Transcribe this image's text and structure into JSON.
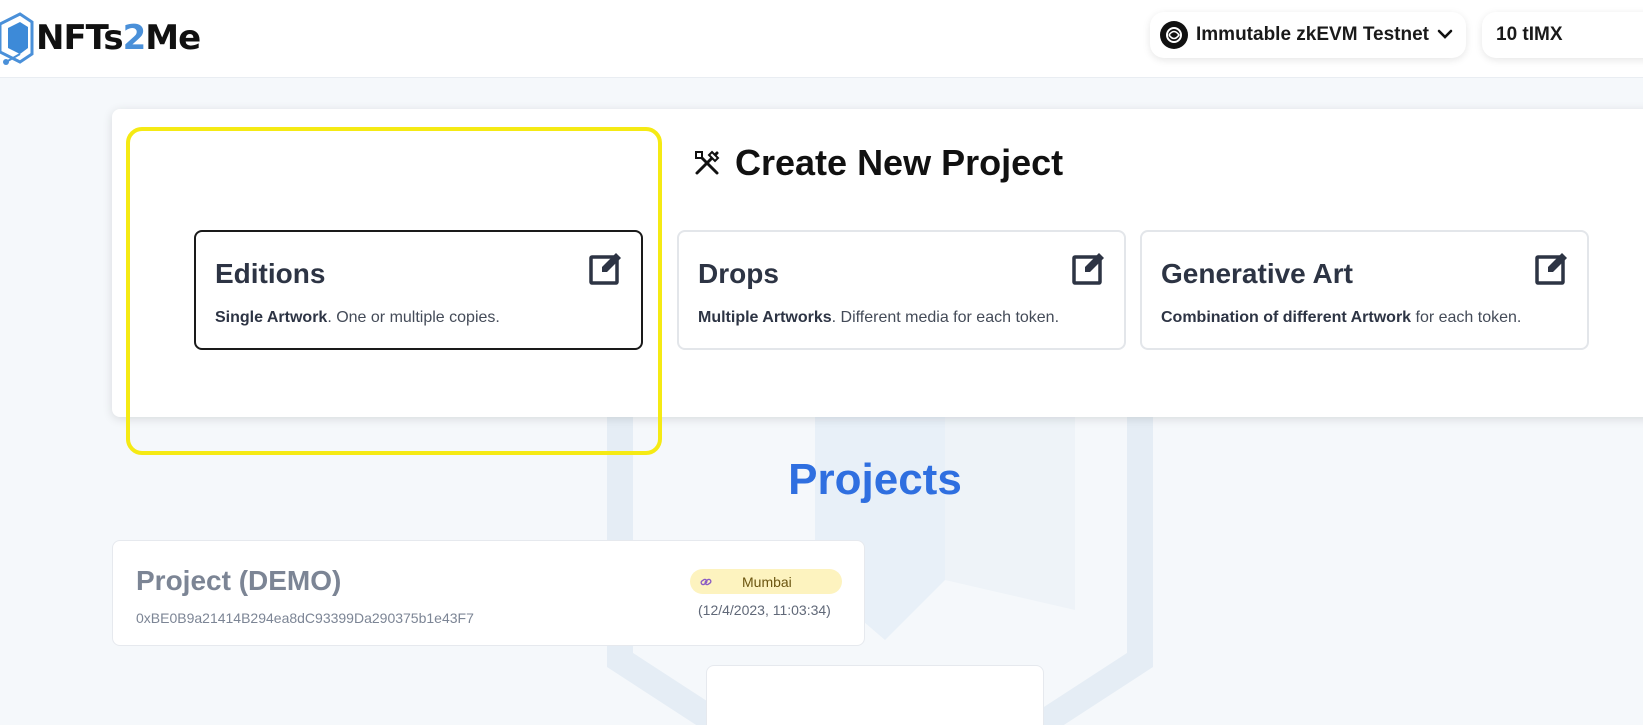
{
  "header": {
    "logo_text_a": "NFTs",
    "logo_text_b": "2",
    "logo_text_c": "Me",
    "network_label": "Immutable zkEVM Testnet",
    "balance_label": "10 tIMX"
  },
  "create": {
    "title": "Create New Project",
    "cards": [
      {
        "title": "Editions",
        "desc_bold": "Single Artwork",
        "desc_rest": ". One or multiple copies."
      },
      {
        "title": "Drops",
        "desc_bold": "Multiple Artworks",
        "desc_rest": ". Different media for each token."
      },
      {
        "title": "Generative Art",
        "desc_bold": "Combination of different Artwork",
        "desc_rest": " for each token."
      }
    ]
  },
  "projects": {
    "heading": "Projects",
    "items": [
      {
        "name": "Project (DEMO)",
        "address": "0xBE0B9a21414B294ea8dC93399Da290375b1e43F7",
        "network": "Mumbai",
        "date": "(12/4/2023, 11:03:34)"
      }
    ]
  },
  "colors": {
    "accent": "#2f6fe0",
    "highlight": "#f5ea14",
    "badge_bg": "#fdf3bf"
  }
}
